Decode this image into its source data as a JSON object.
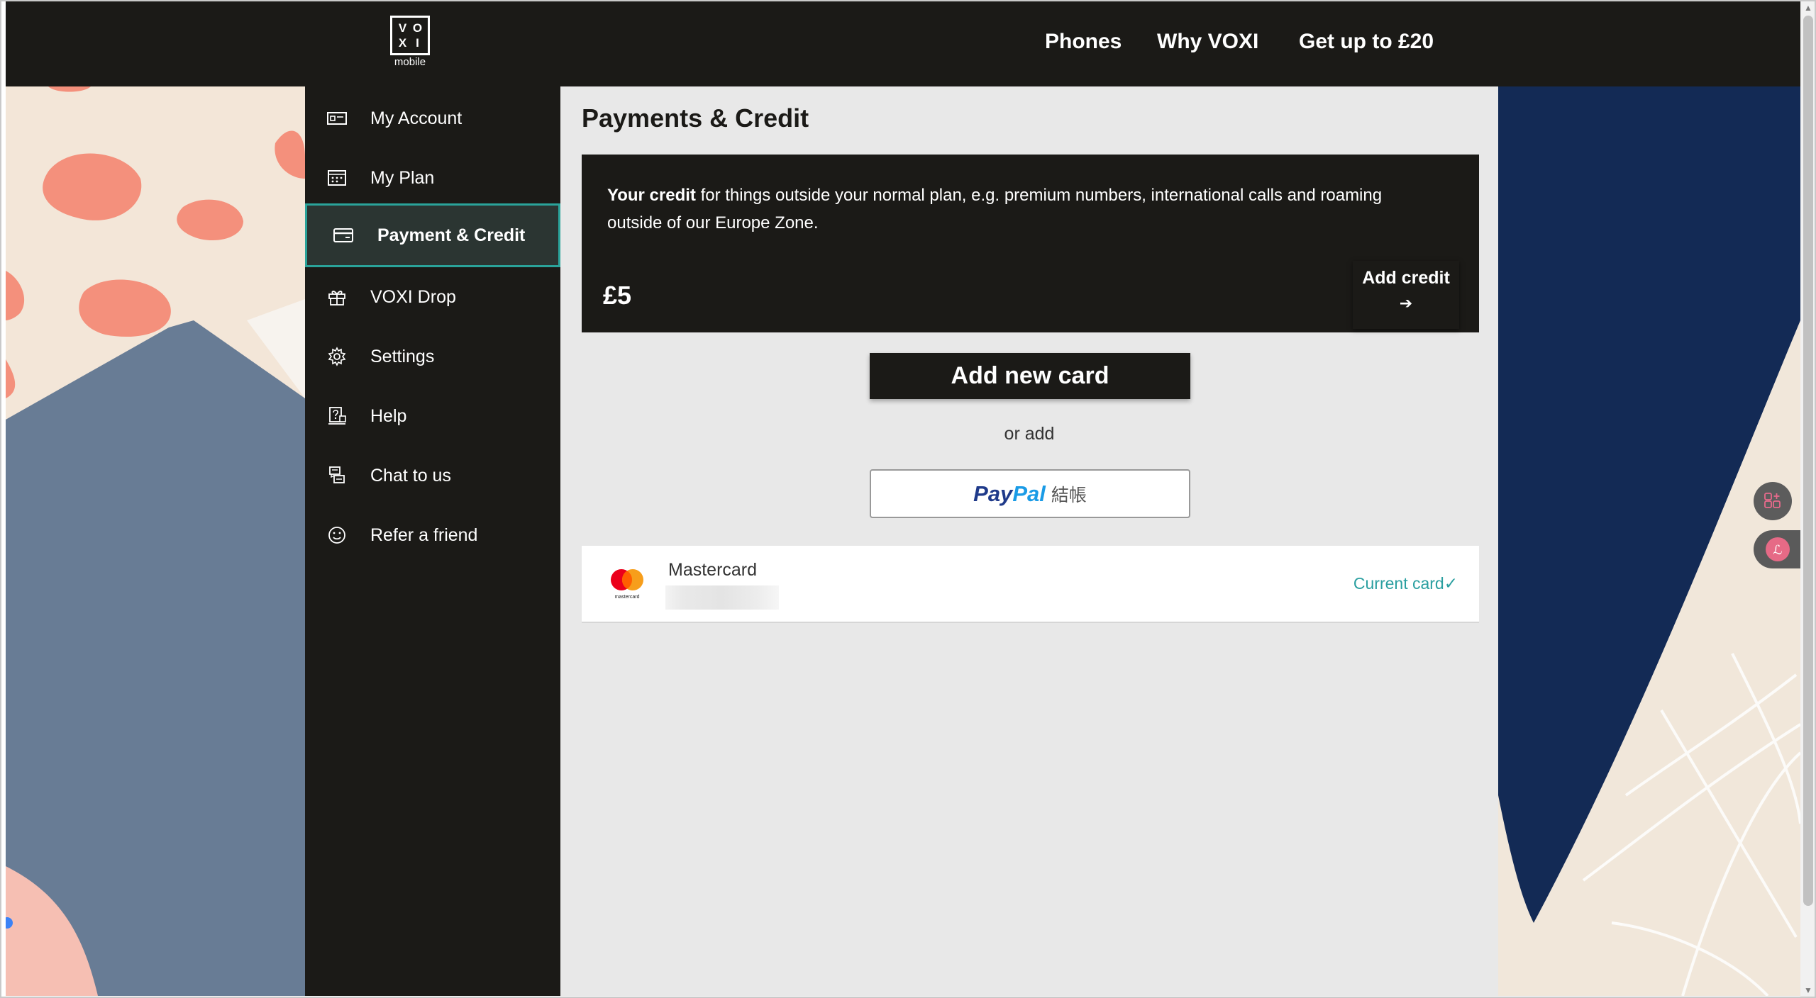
{
  "brand": {
    "logo_letters": [
      "V",
      "O",
      "X",
      "I"
    ],
    "logo_sub": "mobile",
    "colors": {
      "dark": "#1b1a17",
      "teal": "#2aa39a",
      "link": "#2a9fa0",
      "paypal_dark": "#1f3a8a",
      "paypal_light": "#1a9be6"
    }
  },
  "topnav": {
    "items": [
      {
        "label": "Phones"
      },
      {
        "label": "Why VOXI"
      },
      {
        "label": "Get up to £20"
      }
    ]
  },
  "sidebar": {
    "items": [
      {
        "label": "My Account",
        "icon": "account-card-icon"
      },
      {
        "label": "My Plan",
        "icon": "plan-grid-icon"
      },
      {
        "label": "Payment & Credit",
        "icon": "credit-card-icon",
        "active": true
      },
      {
        "label": "VOXI Drop",
        "icon": "gift-icon"
      },
      {
        "label": "Settings",
        "icon": "gear-icon"
      },
      {
        "label": "Help",
        "icon": "help-document-icon"
      },
      {
        "label": "Chat to us",
        "icon": "chat-icon"
      },
      {
        "label": "Refer a friend",
        "icon": "smiley-icon"
      }
    ]
  },
  "main": {
    "title": "Payments & Credit",
    "credit": {
      "desc_bold": "Your credit",
      "desc_rest": " for things outside your normal plan, e.g. premium numbers, international calls and roaming outside of our Europe Zone.",
      "amount": "£5",
      "add_label": "Add credit",
      "add_arrow": "➔"
    },
    "add_card_label": "Add new card",
    "or_add": "or add",
    "paypal": {
      "pay": "Pay",
      "pal": "Pal",
      "suffix": "結帳"
    },
    "card": {
      "brand": "Mastercard",
      "logo_text": "mastercard",
      "status": "Current card✓"
    }
  },
  "widgets": {
    "apps_icon": "apps-plus-icon",
    "translate_icon": "translate-icon"
  }
}
